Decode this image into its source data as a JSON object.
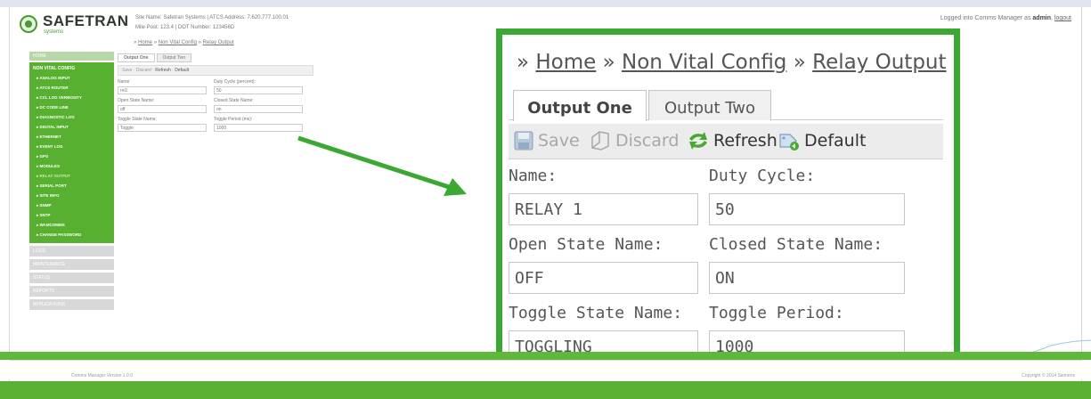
{
  "brand": {
    "name": "SAFETRAN",
    "tagline": "systems"
  },
  "site": {
    "line1": "Site Name: Safetran Systems | ATCS Address: 7.620.777.100.01",
    "line2": "Mile Post: 123.4          | DOT Number: 123456D"
  },
  "login": {
    "prefix": "Logged into Comms Manager as",
    "user": "admin",
    "logout": "logout"
  },
  "breadcrumb": {
    "sep": "»",
    "items": [
      "Home",
      "Non Vital Config",
      "Relay Output"
    ]
  },
  "sidebar": {
    "home": "HOME",
    "group_title": "NON VITAL CONFIG",
    "items": [
      "ANALOG INPUT",
      "ATCS ROUTER",
      "CCL LOG VERBOSITY",
      "DC CODE LINE",
      "DIAGNOSTIC LOG",
      "DIGITAL INPUT",
      "ETHERNET",
      "EVENT LOG",
      "GPS",
      "MODULES",
      "RELAY OUTPUT",
      "SERIAL PORT",
      "SITE INFO",
      "SNMP",
      "SNTP",
      "WAMCOMMS",
      "CHANGE PASSWORD"
    ],
    "selected_index": 10,
    "other_groups": [
      "LOGS",
      "MAINTENANCE",
      "STATUS",
      "REPORTS",
      "APPLICATIONS"
    ]
  },
  "tabs": [
    "Output One",
    "Output Two"
  ],
  "toolbar": {
    "save": "Save",
    "discard": "Discard",
    "refresh": "Refresh",
    "default": "Default"
  },
  "mini": {
    "labels": {
      "name": "Name:",
      "duty": "Duty Cycle (percent):",
      "open": "Open State Name:",
      "closed": "Closed State Name:",
      "toggle": "Toggle State Name:",
      "period": "Toggle Period (ms):"
    },
    "values": {
      "name": "rel1",
      "duty": "50",
      "open": "off",
      "closed": "on",
      "toggle": "Toggle",
      "period": "1000"
    }
  },
  "form": {
    "labels": {
      "name": "Name:",
      "duty": "Duty Cycle:",
      "open": "Open State Name:",
      "closed": "Closed State Name:",
      "toggle": "Toggle State Name:",
      "period": "Toggle Period:"
    },
    "values": {
      "name": "RELAY 1",
      "duty": "50",
      "open": "OFF",
      "closed": "ON",
      "toggle": "TOGGLING",
      "period": "1000"
    }
  },
  "footer": {
    "version": "Comms Manager Version 1.0.0",
    "copyright": "Copyright © 2014 Siemens"
  },
  "colors": {
    "accent": "#3aa832",
    "sidebar": "#58b030"
  }
}
